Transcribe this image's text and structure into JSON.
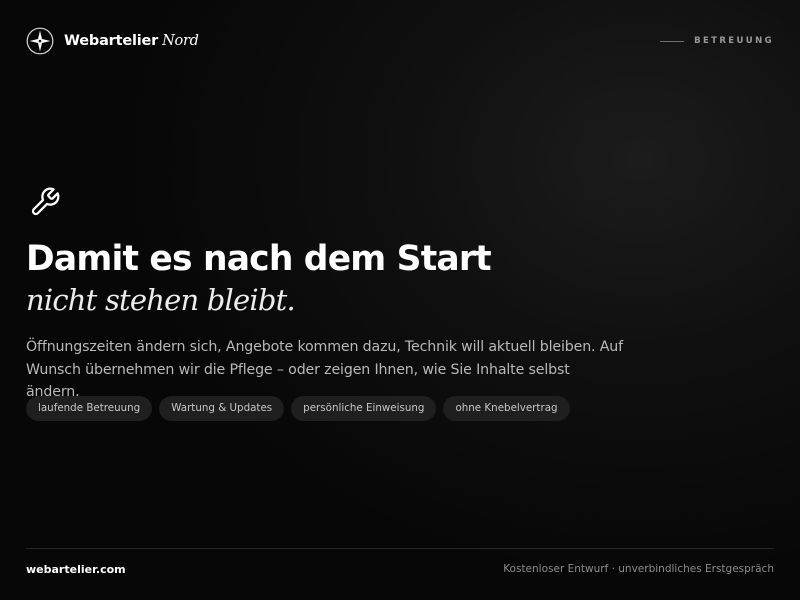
{
  "header": {
    "brand_name": "Webartelier",
    "brand_accent": "Nord",
    "logo_icon": "compass-star-icon",
    "section_label": "BETREUUNG"
  },
  "hero": {
    "icon": "wrench-icon",
    "title": "Damit es nach dem Start",
    "title_italic": "nicht stehen bleibt.",
    "description": "Öffnungszeiten ändern sich, Angebote kommen dazu, Technik will aktuell bleiben. Auf Wunsch übernehmen wir die Pflege – oder zeigen Ihnen, wie Sie Inhalte selbst ändern.",
    "chips": [
      "laufende Betreuung",
      "Wartung & Updates",
      "persönliche Einweisung",
      "ohne Knebelvertrag"
    ]
  },
  "footer": {
    "domain": "webartelier.com",
    "tagline": "Kostenloser Entwurf · unverbindliches Erstgespräch"
  },
  "colors": {
    "background": "#080808",
    "text": "#ffffff",
    "muted": "#b9b9b9",
    "chip_bg": "#1f1f1f"
  }
}
